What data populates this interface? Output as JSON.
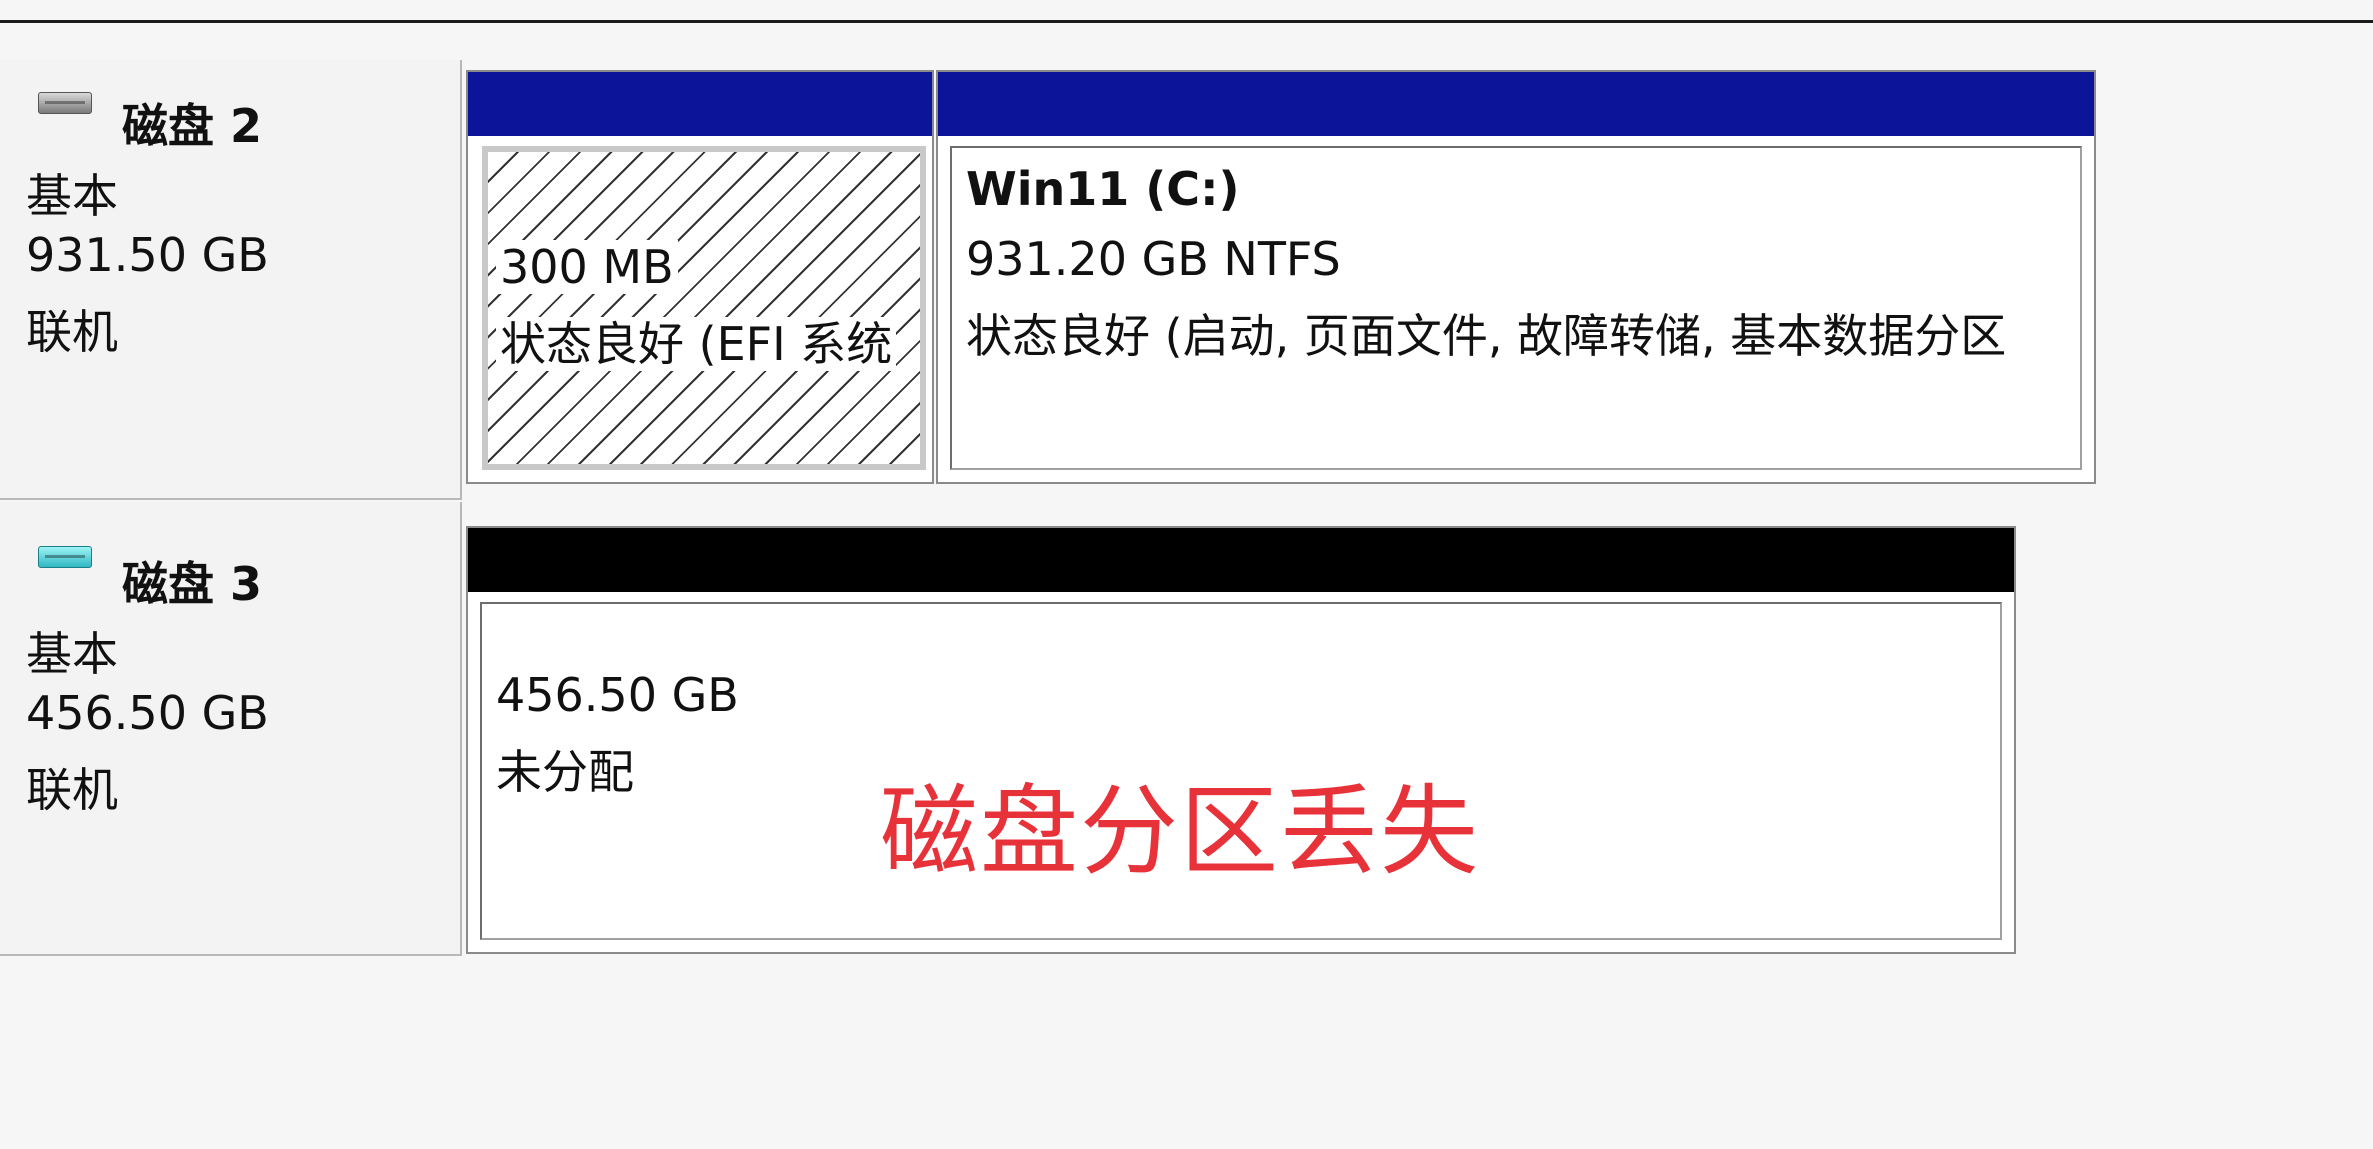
{
  "disks": [
    {
      "name": "磁盘 2",
      "type": "基本",
      "size": "931.50 GB",
      "status": "联机",
      "icon": "disk-drive-icon",
      "partitions": [
        {
          "size": "300 MB",
          "status": "状态良好 (EFI 系统"
        },
        {
          "title": "Win11  (C:)",
          "size": "931.20 GB NTFS",
          "status": "状态良好 (启动, 页面文件, 故障转储, 基本数据分区"
        }
      ]
    },
    {
      "name": "磁盘 3",
      "type": "基本",
      "size": "456.50 GB",
      "status": "联机",
      "icon": "ssd-drive-icon",
      "partitions": [
        {
          "size": "456.50 GB",
          "status": "未分配"
        }
      ]
    }
  ],
  "annotation": "磁盘分区丢失",
  "colors": {
    "primary_bar": "#0c1599",
    "unallocated_bar": "#000000",
    "annotation": "#e8323a"
  }
}
